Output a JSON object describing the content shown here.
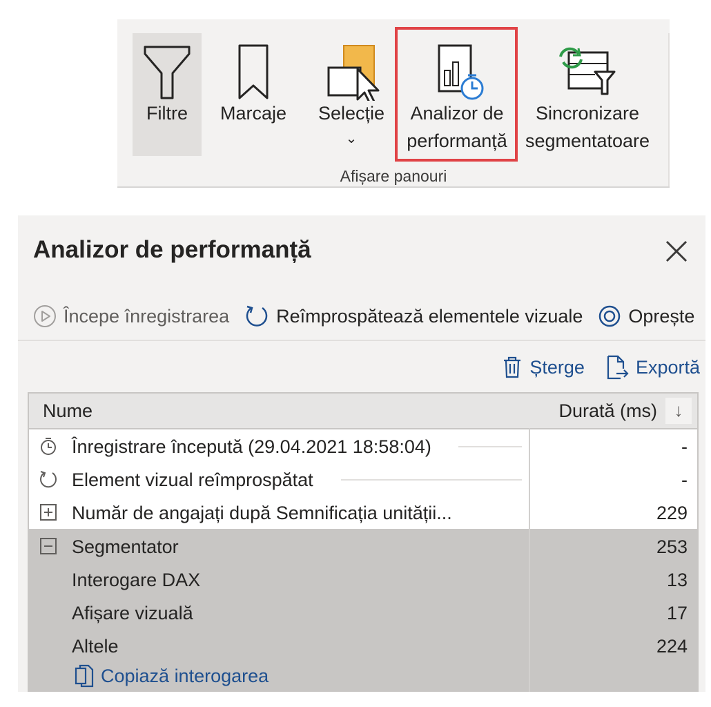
{
  "ribbon": {
    "buttons": [
      {
        "label": "Filtre",
        "icon": "filter-icon"
      },
      {
        "label": "Marcaje",
        "icon": "bookmark-icon"
      },
      {
        "label": "Selecție",
        "icon": "selection-icon",
        "chevron": "⌄"
      },
      {
        "label_line1": "Analizor de",
        "label_line2": "performanță",
        "icon": "performance-analyzer-icon"
      },
      {
        "label_line1": "Sincronizare",
        "label_line2": "segmentatoare",
        "icon": "sync-slicers-icon"
      }
    ],
    "group_label": "Afișare panouri",
    "highlight_color": "#e04346"
  },
  "pane": {
    "title": "Analizor de performanță",
    "toolbar": {
      "start": "Începe înregistrarea",
      "refresh": "Reîmprospătează elementele vizuale",
      "stop": "Oprește"
    },
    "actions": {
      "clear": "Șterge",
      "export": "Exportă"
    },
    "table": {
      "col_name": "Nume",
      "col_duration": "Durată (ms)",
      "sort_icon": "↓",
      "rows": [
        {
          "name": "Înregistrare începută (29.04.2021 18:58:04)",
          "duration": "-",
          "icon": "stopwatch-icon"
        },
        {
          "name": "Element vizual reîmprospătat",
          "duration": "-",
          "icon": "refresh-icon"
        },
        {
          "name": "Număr de angajați după Semnificația unității...",
          "duration": "229",
          "icon": "expand-icon"
        },
        {
          "name": "Segmentator",
          "duration": "253",
          "icon": "collapse-icon"
        },
        {
          "name": "Interogare DAX",
          "duration": "13"
        },
        {
          "name": "Afișare vizuală",
          "duration": "17"
        },
        {
          "name": "Altele",
          "duration": "224"
        }
      ],
      "copy_query": "Copiază interogarea"
    }
  },
  "colors": {
    "link": "#1e4f8f",
    "pane_bg": "#f3f2f1",
    "selected_bg": "#c8c6c4",
    "icon_blue": "#2b7cd3",
    "icon_green": "#2e9b48",
    "icon_orange": "#f2b84b"
  }
}
